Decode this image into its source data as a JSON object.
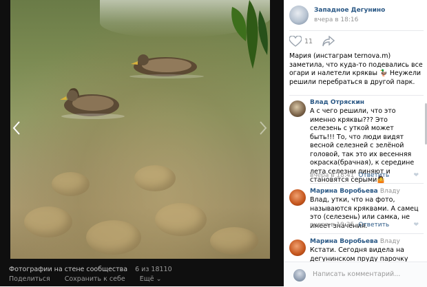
{
  "viewer": {
    "caption_title": "Фотографии на стене сообщества",
    "counter": "6 из 18110",
    "actions": {
      "share": "Поделиться",
      "save": "Сохранить к себе",
      "more": "Ещё ⌄"
    },
    "prev_icon": "chevron-left-icon",
    "next_icon": "chevron-right-icon"
  },
  "post": {
    "group_name": "Западное Дегунино",
    "date": "вчера в 18:16",
    "likes_count": "11",
    "text": "Мария (инстаграм ternova.m) заметила, что куда-то подевались все огари и налетели кряквы 🦆 Неужели решили перебраться в другой парк."
  },
  "comments": [
    {
      "author": "Влад Отряскин",
      "reply_to": "",
      "text": "А с чего решили, что это именно кряквы??? Это селезень с уткой может быть!!! То, что люди видят весной селезней с зелёной головой, так это их весенняя окраска(брачная), к середине лета селезни линяют и становятся серыми🤷",
      "date": "вчера в 18:41",
      "reply_label": "Ответить"
    },
    {
      "author": "Марина Воробьева",
      "reply_to": "Владу",
      "text": "Влад, утки, что на фото, называются кряквами. А самец это (селезень) или самка, не имеет значения.",
      "date": "вчера в 19:25",
      "reply_label": "Ответить"
    },
    {
      "author": "Марина Воробьева",
      "reply_to": "Владу",
      "text": "Кстати. Сегодня видела на дегунинском пруду парочку огарей.",
      "date": "",
      "reply_label": ""
    }
  ],
  "composer": {
    "placeholder": "Написать комментарий..."
  },
  "colors": {
    "link": "#2a5885",
    "muted": "#939393",
    "viewer_bg": "#0f0f0f"
  }
}
